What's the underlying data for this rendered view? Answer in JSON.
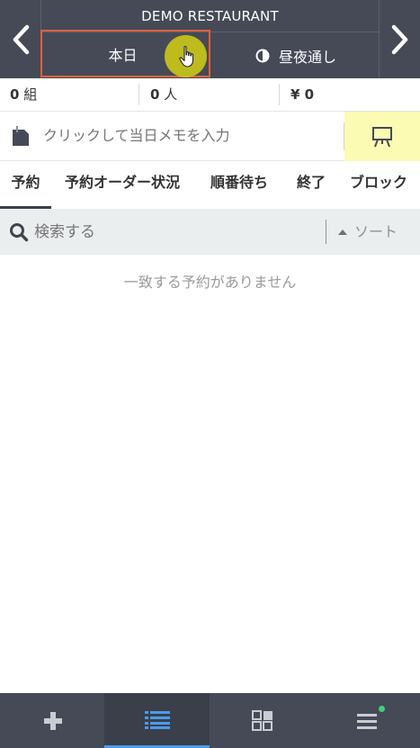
{
  "header": {
    "restaurant_name": "DEMO RESTAURANT",
    "tab_today": "本日",
    "tab_daynight": "昼夜通し"
  },
  "stats": {
    "groups_value": "0",
    "groups_unit": "組",
    "people_value": "0",
    "people_unit": "人",
    "amount": "¥ 0"
  },
  "memo": {
    "placeholder": "クリックして当日メモを入力"
  },
  "tabs": [
    {
      "label": "予約"
    },
    {
      "label": "予約オーダー状況"
    },
    {
      "label": "順番待ち"
    },
    {
      "label": "終了"
    },
    {
      "label": "ブロック"
    }
  ],
  "search": {
    "placeholder": "検索する",
    "sort_label": "ソート"
  },
  "empty_message": "一致する予約がありません",
  "colors": {
    "header_bg": "#454a56",
    "highlight_border": "#e0603e",
    "memo_button_bg": "#fbfbb4",
    "active_indicator": "#4a9bea",
    "notification": "#3dd17a"
  },
  "icons": {
    "prev": "chevron-left-icon",
    "next": "chevron-right-icon",
    "daynight": "half-circle-icon",
    "memo": "note-icon",
    "memo_button": "easel-icon",
    "search": "search-icon",
    "add": "plus-icon",
    "list": "list-icon",
    "grid": "grid-icon",
    "menu": "menu-icon"
  }
}
